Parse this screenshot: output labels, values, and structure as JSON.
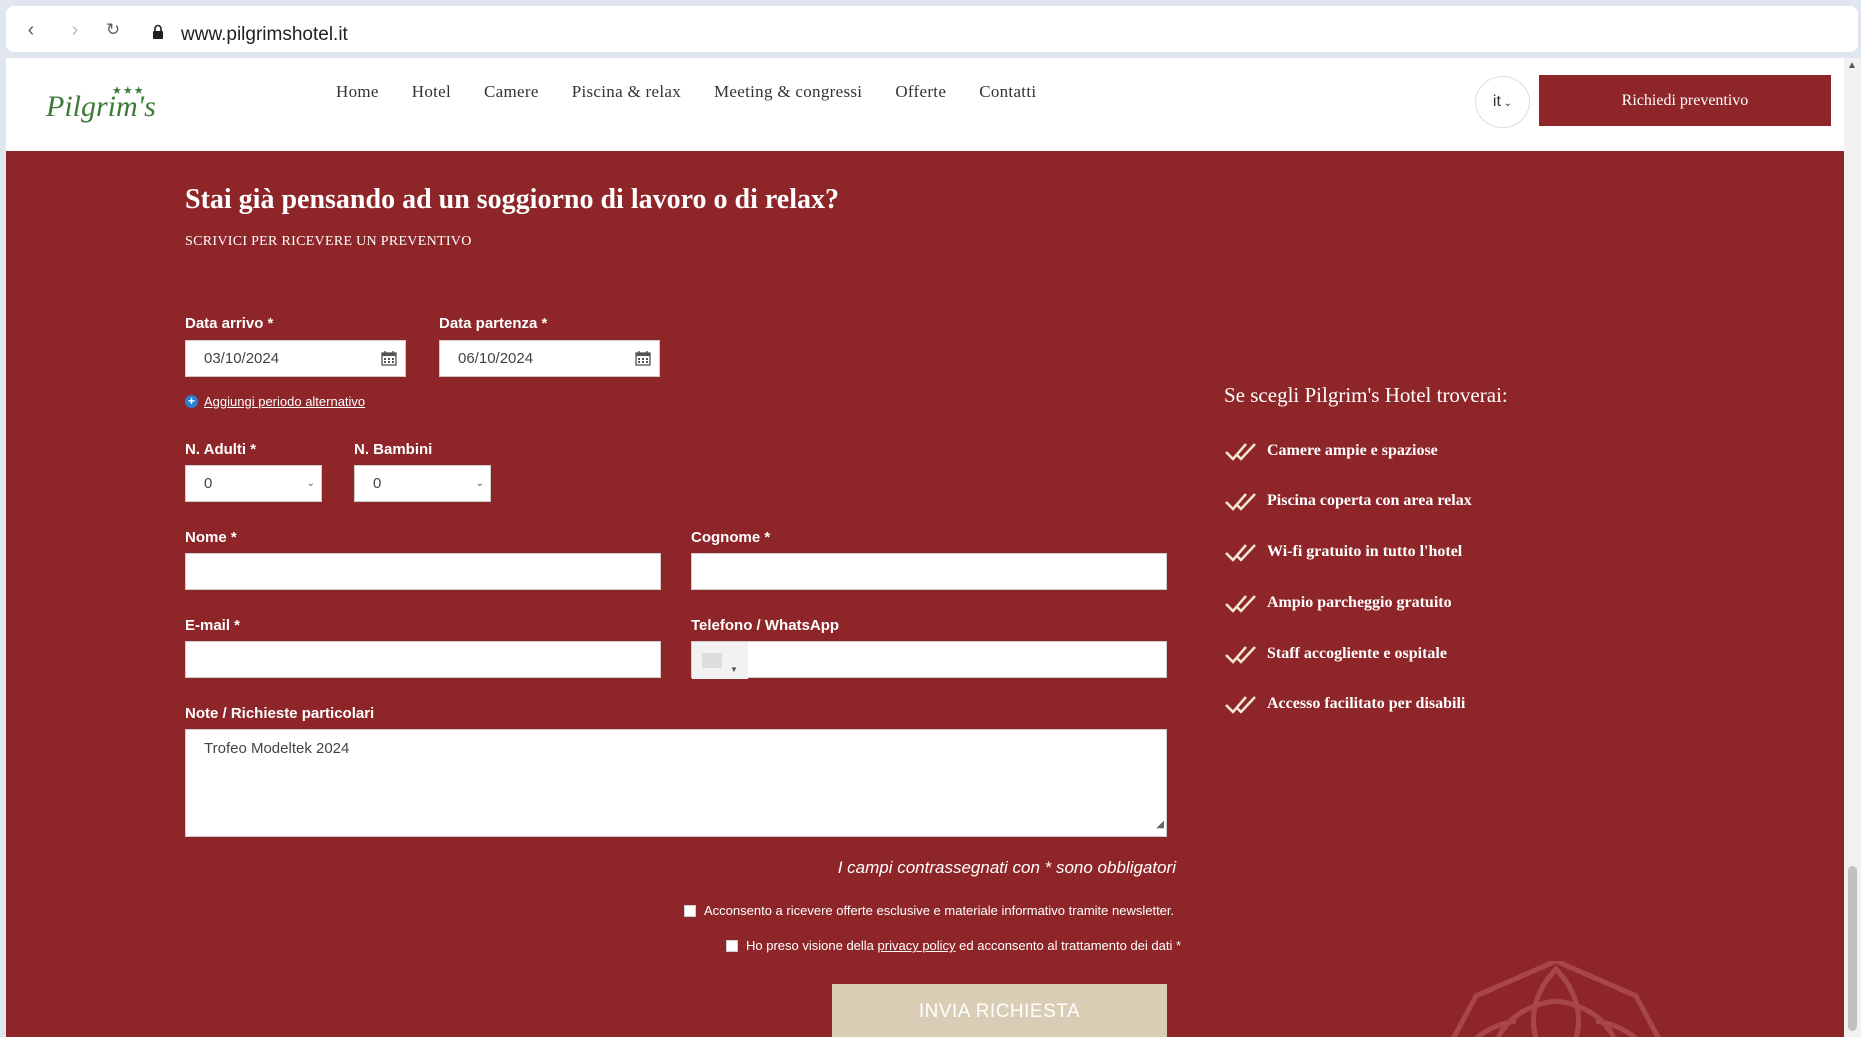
{
  "browser": {
    "url": "www.pilgrimshotel.it"
  },
  "header": {
    "logo_text": "Pilgrim's",
    "logo_stars": "★★★",
    "menu": [
      {
        "label": "Home"
      },
      {
        "label": "Hotel"
      },
      {
        "label": "Camere"
      },
      {
        "label": "Piscina & relax"
      },
      {
        "label": "Meeting & congressi"
      },
      {
        "label": "Offerte"
      },
      {
        "label": "Contatti"
      }
    ],
    "language": "it",
    "cta_label": "Richiedi preventivo"
  },
  "form": {
    "title": "Stai già pensando ad un soggiorno di lavoro o di relax?",
    "subtitle": "SCRIVICI PER RICEVERE UN PREVENTIVO",
    "arrival_label": "Data arrivo *",
    "arrival_value": "03/10/2024",
    "departure_label": "Data partenza *",
    "departure_value": "06/10/2024",
    "add_alt_label": "Aggiungi periodo alternativo",
    "adults_label": "N. Adulti *",
    "adults_value": "0",
    "children_label": "N. Bambini",
    "children_value": "0",
    "name_label": "Nome *",
    "name_value": "",
    "surname_label": "Cognome *",
    "surname_value": "",
    "email_label": "E-mail *",
    "email_value": "",
    "phone_label": "Telefono / WhatsApp",
    "phone_value": "",
    "notes_label": "Note / Richieste particolari",
    "notes_value": "Trofeo Modeltek 2024",
    "required_note": "I campi contrassegnati con * sono obbligatori",
    "newsletter_consent": "Acconsento a ricevere offerte esclusive e materiale informativo tramite newsletter.",
    "privacy_prefix": "Ho preso visione della ",
    "privacy_link": "privacy policy",
    "privacy_suffix": " ed acconsento al trattamento dei dati *",
    "submit_label": "INVIA RICHIESTA"
  },
  "sidebar": {
    "title": "Se scegli Pilgrim's Hotel troverai:",
    "features": [
      {
        "label": "Camere ampie e spaziose"
      },
      {
        "label": "Piscina coperta con area relax"
      },
      {
        "label": "Wi-fi gratuito in tutto l'hotel"
      },
      {
        "label": "Ampio parcheggio gratuito"
      },
      {
        "label": "Staff accogliente e ospitale"
      },
      {
        "label": "Accesso facilitato per disabili"
      }
    ]
  },
  "colors": {
    "brand_red": "#8e2629",
    "submit_beige": "#d9cdb5",
    "logo_green": "#3d7a3a"
  }
}
